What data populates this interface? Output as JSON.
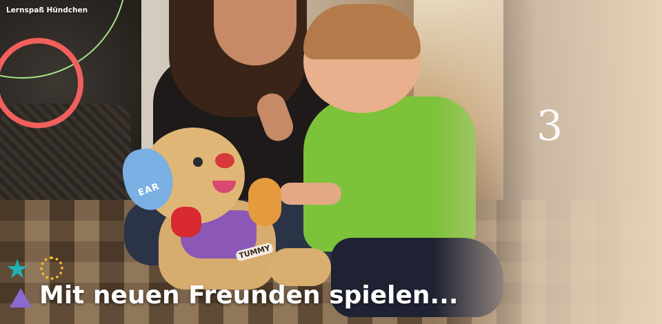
{
  "brand": {
    "title": "Lernspaß Hündchen"
  },
  "slide": {
    "number": "3"
  },
  "caption": {
    "text": "Mit neuen Freunden spielen..."
  },
  "toy": {
    "ear_label": "EAR",
    "tummy_label": "TUMMY"
  },
  "colors": {
    "circle_red": "#f2605c",
    "arc_green": "#a6e48a",
    "star_teal": "#1fb2b6",
    "ring_yellow": "#f3b530",
    "triangle_purple": "#8a6ad0"
  },
  "icons": [
    "star-icon",
    "dotted-ring-icon",
    "triangle-icon"
  ]
}
